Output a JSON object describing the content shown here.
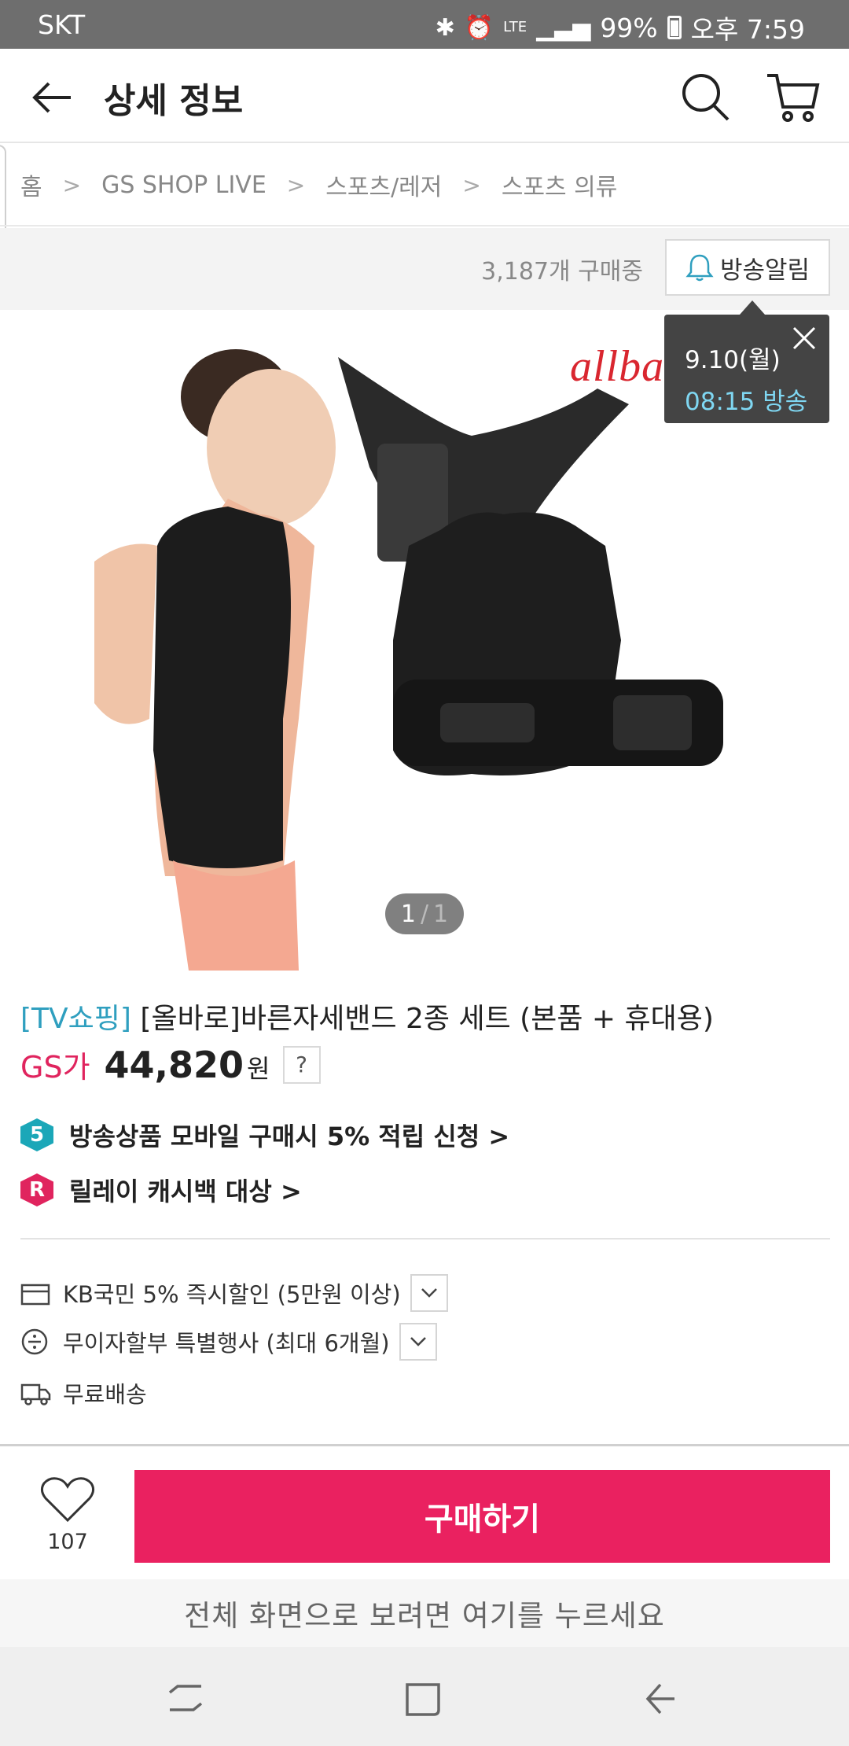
{
  "status_bar": {
    "carrier": "SKT",
    "icons": [
      "bluetooth-icon",
      "alarm-icon",
      "lte-icon",
      "signal-icon",
      "battery-icon"
    ],
    "lte": "LTE",
    "battery": "99%",
    "time": "오후 7:59"
  },
  "header": {
    "title": "상세 정보",
    "back_icon": "arrow-left-icon",
    "search_icon": "search-icon",
    "cart_icon": "cart-icon"
  },
  "breadcrumb": [
    "홈",
    "GS SHOP LIVE",
    "스포츠/레저",
    "스포츠 의류"
  ],
  "buyers": {
    "count_text": "3,187개 구매중",
    "alarm_label": "방송알림"
  },
  "tooltip": {
    "date": "9.10(월)",
    "time": "08:15 방송"
  },
  "image": {
    "brand_text": "allbar",
    "page_current": "1",
    "page_sep": "/",
    "page_total": "1"
  },
  "product": {
    "tag": "[TV쇼핑]",
    "name": "[올바로]바른자세밴드 2종 세트 (본품 + 휴대용)",
    "price_label": "GS가",
    "price": "44,820",
    "currency": "원",
    "help": "?"
  },
  "promos": [
    {
      "badge": "5",
      "text": "방송상품 모바일 구매시 5% 적립 신청 >"
    },
    {
      "badge": "R",
      "text": "릴레이 캐시백 대상 >"
    }
  ],
  "benefits": [
    {
      "icon": "card-icon",
      "text": "KB국민 5% 즉시할인 (5만원 이상)"
    },
    {
      "icon": "installment-icon",
      "text": "무이자할부 특별행사 (최대 6개월)"
    },
    {
      "icon": "truck-icon",
      "text": "무료배송"
    }
  ],
  "bottom": {
    "like_count": "107",
    "buy_label": "구매하기",
    "fullscreen_hint": "전체 화면으로 보려면 여기를 누르세요"
  },
  "colors": {
    "accent_pink": "#ea2160",
    "tag_teal": "#2f9fbf",
    "tooltip_time": "#7fd7f2"
  }
}
